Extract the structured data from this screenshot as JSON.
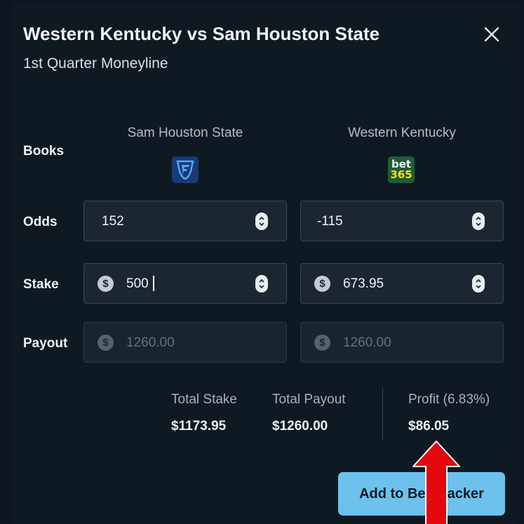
{
  "modal": {
    "title": "Western Kentucky vs Sam Houston State",
    "subtitle": "1st Quarter Moneyline"
  },
  "columns": [
    {
      "team": "Sam Houston State",
      "book_icon": "fanduel-logo"
    },
    {
      "team": "Western Kentucky",
      "book_icon": "bet365-logo",
      "book_logo_text": [
        "bet",
        "365"
      ]
    }
  ],
  "rows": {
    "books_label": "Books",
    "odds_label": "Odds",
    "stake_label": "Stake",
    "payout_label": "Payout"
  },
  "odds": [
    "152",
    "-115"
  ],
  "stake": [
    "500",
    "673.95"
  ],
  "payout_placeholder": [
    "1260.00",
    "1260.00"
  ],
  "currency_symbol": "$",
  "summary": {
    "total_stake_label": "Total Stake",
    "total_stake_value": "$1173.95",
    "total_payout_label": "Total Payout",
    "total_payout_value": "$1260.00",
    "profit_label": "Profit (6.83%)",
    "profit_value": "$86.05"
  },
  "actions": {
    "add_label": "Add to Bet Tracker"
  },
  "colors": {
    "background": "#0f1922",
    "accent_button": "#6cc2ed",
    "annotation_arrow": "#e3090f"
  }
}
